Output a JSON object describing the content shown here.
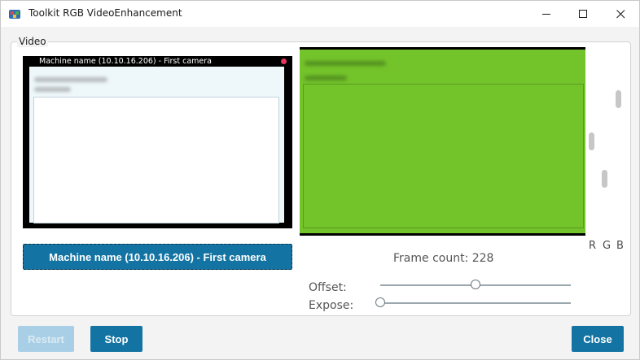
{
  "window": {
    "title": "Toolkit RGB VideoEnhancement"
  },
  "group": {
    "legend": "Video"
  },
  "camera": {
    "overlay_title": "Machine name (10.10.16.206) - First camera",
    "button_label": "Machine name (10.10.16.206) - First camera"
  },
  "rgb": {
    "labels": [
      "R",
      "G",
      "B"
    ],
    "levels": {
      "R": 0.1,
      "G": 0.5,
      "B": 0.85
    },
    "preview_color": "#73c32b"
  },
  "frame": {
    "count_text": "Frame count: 228"
  },
  "sliders": {
    "offset_label": "Offset:",
    "offset_value": 0.5,
    "expose_label": "Expose:",
    "expose_value": 0.0
  },
  "buttons": {
    "restart": "Restart",
    "stop": "Stop",
    "close": "Close"
  },
  "colors": {
    "accent": "#1374a3",
    "accent_disabled": "#a9cfe6"
  }
}
